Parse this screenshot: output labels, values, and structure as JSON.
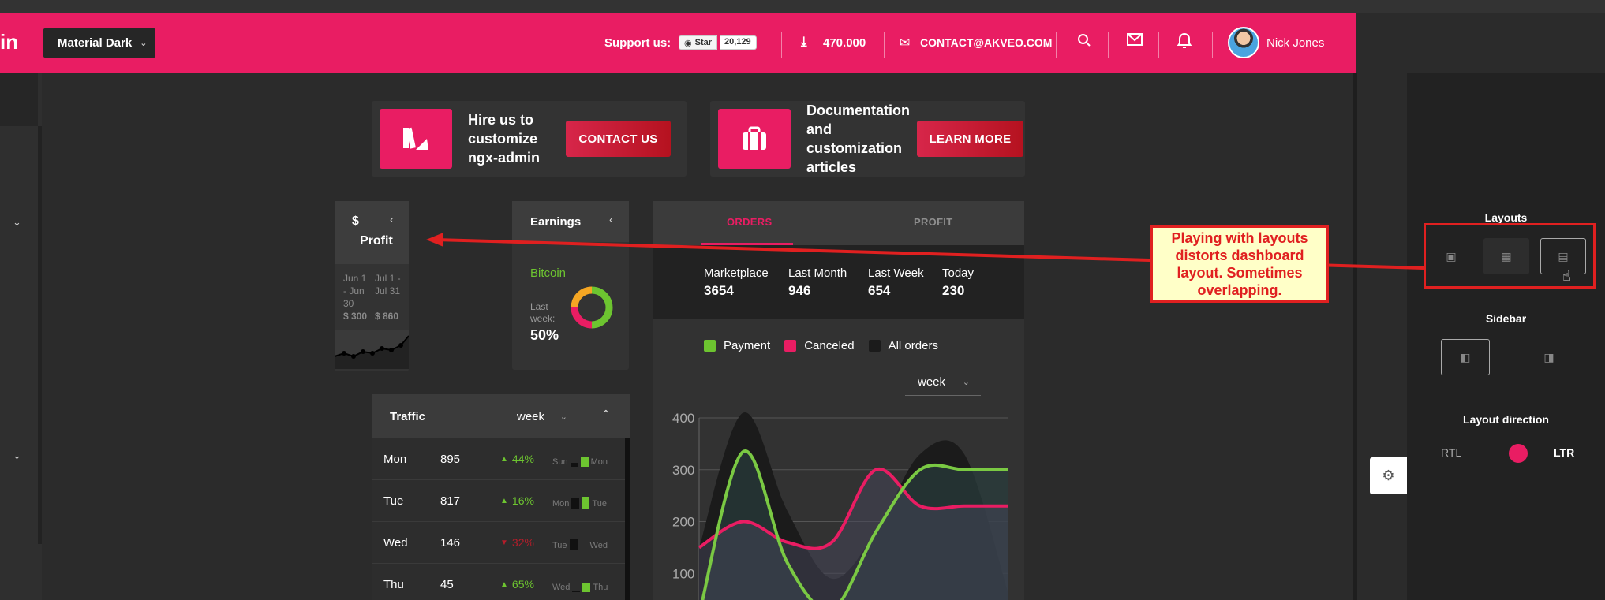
{
  "header": {
    "logo_fragment": "in",
    "theme_select": "Material Dark",
    "support_label": "Support us:",
    "github_star": "Star",
    "github_count": "20,129",
    "download_count": "470.000",
    "contact_email": "CONTACT@AKVEO.COM",
    "user_name": "Nick Jones",
    "icons": [
      "search-icon",
      "mail-icon",
      "bell-icon",
      "download-icon"
    ]
  },
  "promos": [
    {
      "title": "Hire us to customize ngx-admin",
      "button": "CONTACT US"
    },
    {
      "title": "Documentation and customization articles",
      "button": "LEARN MORE"
    }
  ],
  "profit_card": {
    "currency_symbol": "$",
    "title": "Profit",
    "periods": [
      {
        "label": "Jun 1 - Jun 30",
        "value": "$ 300"
      },
      {
        "label": "Jul 1 - Jul 31",
        "value": "$ 860"
      }
    ]
  },
  "earnings_card": {
    "title": "Earnings",
    "currency": "Bitcoin",
    "last_week_label": "Last week:",
    "last_week_value": "50%"
  },
  "orders_card": {
    "tabs": [
      {
        "label": "ORDERS",
        "active": true
      },
      {
        "label": "PROFIT",
        "active": false
      }
    ],
    "summary": [
      {
        "label": "Marketplace",
        "value": "3654"
      },
      {
        "label": "Last Month",
        "value": "946"
      },
      {
        "label": "Last Week",
        "value": "654"
      },
      {
        "label": "Today",
        "value": "230"
      }
    ],
    "legend": [
      {
        "name": "Payment",
        "color": "#6dc430"
      },
      {
        "name": "Canceled",
        "color": "#e91d63"
      },
      {
        "name": "All orders",
        "color": "#1b1b1b"
      }
    ],
    "period_select": "week"
  },
  "chart_data": {
    "type": "area",
    "y_ticks": [
      "400",
      "300",
      "200",
      "100"
    ],
    "ylim": [
      0,
      400
    ],
    "grid": true,
    "series": [
      {
        "name": "All orders",
        "values": [
          150,
          410,
          220,
          90,
          180,
          330,
          330,
          60
        ]
      },
      {
        "name": "Payment",
        "values": [
          20,
          335,
          120,
          30,
          180,
          300,
          300,
          300
        ]
      },
      {
        "name": "Canceled",
        "values": [
          150,
          200,
          160,
          160,
          300,
          230,
          230,
          230
        ]
      }
    ]
  },
  "traffic_card": {
    "title": "Traffic",
    "period_select": "week",
    "rows": [
      {
        "day": "Mon",
        "count": "895",
        "delta": "44%",
        "trend": "up",
        "prev_label": "Sun",
        "curr_label": "Mon",
        "prev": 0.3,
        "curr": 0.7
      },
      {
        "day": "Tue",
        "count": "817",
        "delta": "16%",
        "trend": "up",
        "prev_label": "Mon",
        "curr_label": "Tue",
        "prev": 0.75,
        "curr": 0.85
      },
      {
        "day": "Wed",
        "count": "146",
        "delta": "32%",
        "trend": "down",
        "prev_label": "Tue",
        "curr_label": "Wed",
        "prev": 0.85,
        "curr": 0.05
      },
      {
        "day": "Thu",
        "count": "45",
        "delta": "65%",
        "trend": "up",
        "prev_label": "Wed",
        "curr_label": "Thu",
        "prev": 0.05,
        "curr": 0.6
      }
    ],
    "colors": {
      "up": "#6dc430",
      "down": "#b41d2a"
    }
  },
  "settings_panel": {
    "layouts_heading": "Layouts",
    "sidebar_heading": "Sidebar",
    "direction_heading": "Layout direction",
    "rtl": "RTL",
    "ltr": "LTR"
  },
  "annotation": {
    "text": "Playing with layouts distorts dashboard layout. Sometimes overlapping."
  },
  "colors": {
    "accent": "#e91d63",
    "annotation": "#e02020"
  }
}
